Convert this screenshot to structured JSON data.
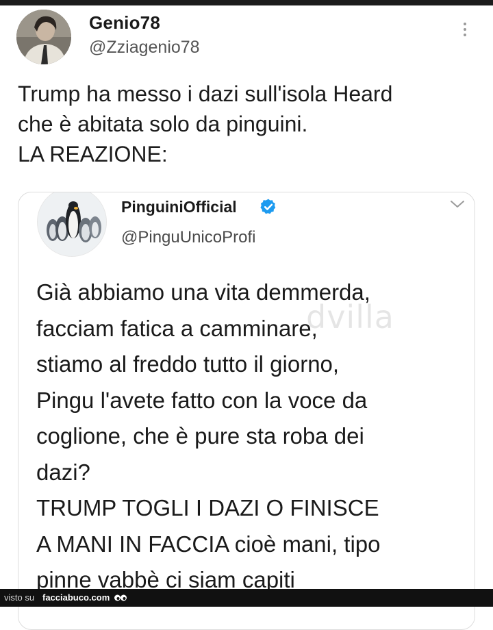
{
  "post": {
    "author_name": "Genio78",
    "author_handle": "@Zziagenio78",
    "text": "Trump ha messo i dazi sull'isola Heard\nche è abitata solo da pinguini.\nLA REAZIONE:",
    "avatar_icon": "user-photo",
    "more_icon": "vertical-ellipsis"
  },
  "quoted": {
    "author_name": "PinguiniOfficial",
    "author_handle": "@PinguUnicoProfi",
    "verified_icon": "verified-badge",
    "verified_color": "#1d9bf0",
    "avatar_icon": "penguin-group",
    "text": "Già abbiamo una vita demmerda,\nfacciam fatica a camminare,\nstiamo al freddo tutto il giorno,\nPingu l'avete fatto con la voce da\ncoglione, che è pure sta roba dei\ndazi?\nTRUMP TOGLI I DAZI O FINISCE\nA MANI IN FACCIA cioè mani, tipo\npinne vabbè ci siam capiti",
    "watermark": "dvilla"
  },
  "footer": {
    "prefix": "visto su",
    "site": "facciabuco.com",
    "logo_icon": "eyes-icon"
  }
}
